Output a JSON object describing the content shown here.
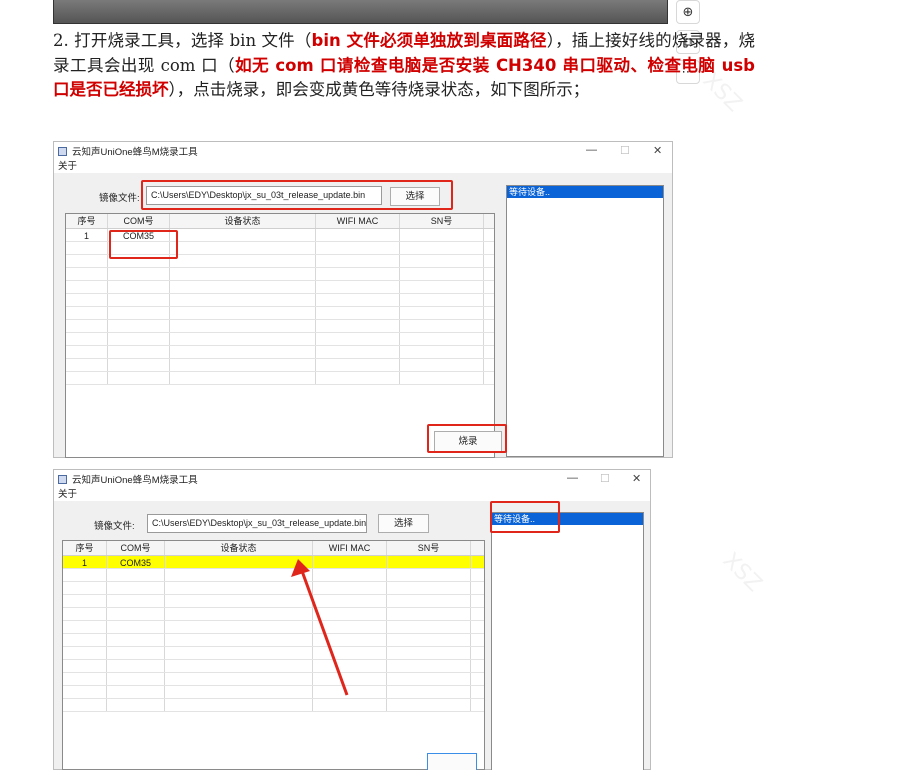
{
  "paragraph": {
    "p1": "2. 打开烧录工具，选择 bin 文件（",
    "r1": "bin 文件必须单独放到桌面路径",
    "p2": "），插上接好线的烧录器，烧录工具会出现 com 口（",
    "r2": "如无 com 口请检查电脑是否安装 CH340 串口驱动、检查电脑 usb 口是否已经损坏",
    "p3": "），点击烧录，即会变成黄色等待烧录状态，如下图所示；"
  },
  "tools": [
    "⊕",
    "⧉",
    "⋯"
  ],
  "win1": {
    "title": "云知声UniOne蜂鸟M烧录工具",
    "menu": "关于",
    "file_label": "镜像文件:",
    "file_value": "C:\\Users\\EDY\\Desktop\\jx_su_03t_release_update.bin",
    "select_btn": "选择",
    "headers": [
      "序号",
      "COM号",
      "设备状态",
      "WIFI MAC",
      "SN号"
    ],
    "row": [
      "1",
      "COM35",
      "",
      "",
      ""
    ],
    "log": "等待设备..",
    "burn_btn": "烧录"
  },
  "win2": {
    "title": "云知声UniOne蜂鸟M烧录工具",
    "menu": "关于",
    "file_label": "镜像文件:",
    "file_value": "C:\\Users\\EDY\\Desktop\\jx_su_03t_release_update.bin",
    "select_btn": "选择",
    "headers": [
      "序号",
      "COM号",
      "设备状态",
      "WIFI MAC",
      "SN号"
    ],
    "row": [
      "1",
      "COM35",
      "",
      "",
      ""
    ],
    "log": "等待设备.."
  },
  "window_controls": [
    "—",
    "☐",
    "✕"
  ],
  "colors": {
    "highlight": "#ffff00",
    "annotation": "#e0251b",
    "log_select": "#0a64d8"
  }
}
